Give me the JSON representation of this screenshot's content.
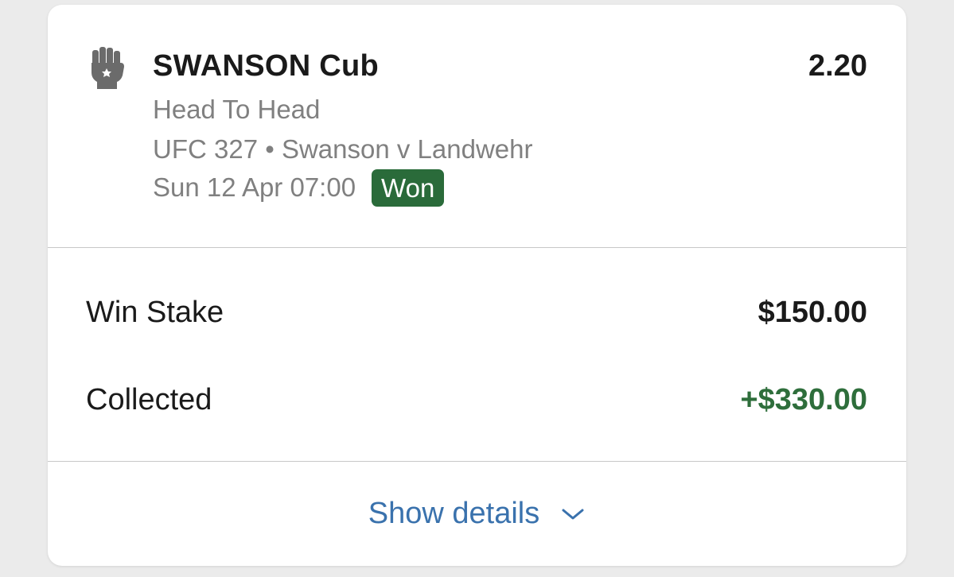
{
  "bet": {
    "sport_icon": "fist-icon",
    "selection": "SWANSON Cub",
    "odds": "2.20",
    "market": "Head To Head",
    "event": "UFC 327 • Swanson v Landwehr",
    "datetime": "Sun 12 Apr 07:00",
    "status": "Won"
  },
  "summary": {
    "stake_label": "Win Stake",
    "stake_value": "$150.00",
    "collected_label": "Collected",
    "collected_value": "+$330.00"
  },
  "footer": {
    "show_details_label": "Show details",
    "chevron_icon": "chevron-down-icon"
  },
  "colors": {
    "won_badge": "#2a6b3a",
    "collected_text": "#2e6e3b",
    "link": "#3a72ad"
  }
}
